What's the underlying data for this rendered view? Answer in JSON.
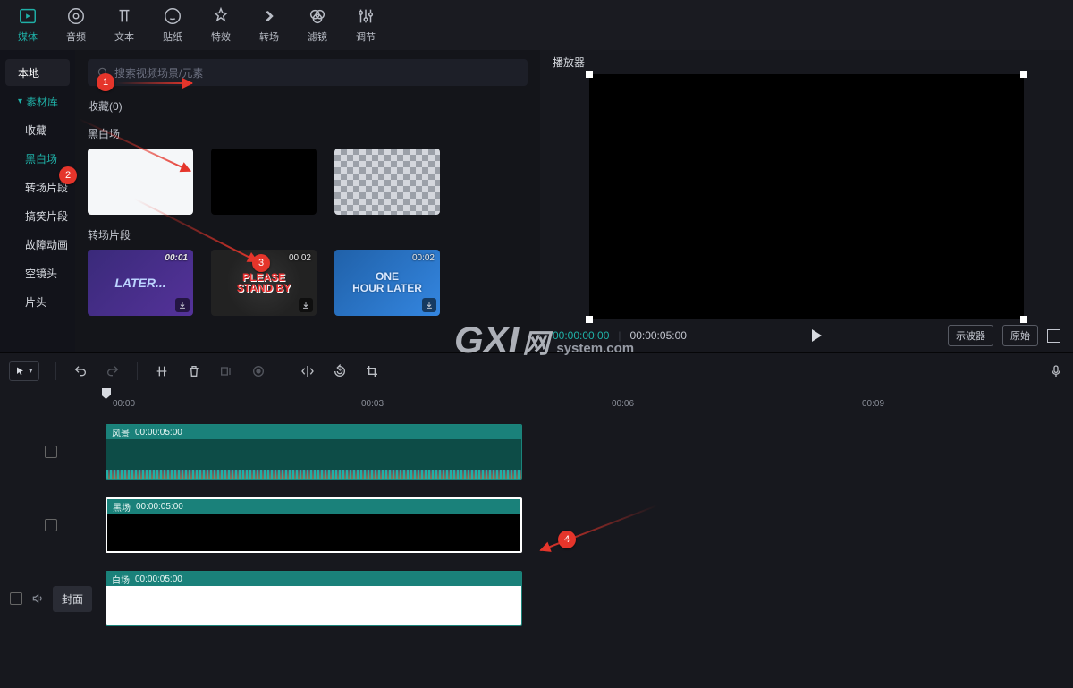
{
  "topTabs": {
    "media": "媒体",
    "audio": "音频",
    "text": "文本",
    "sticker": "贴纸",
    "effect": "特效",
    "transition": "转场",
    "filter": "滤镜",
    "adjust": "调节"
  },
  "side": {
    "local": "本地",
    "library": "素材库",
    "fav": "收藏",
    "bw": "黑白场",
    "trans": "转场片段",
    "funny": "搞笑片段",
    "glitch": "故障动画",
    "empty": "空镜头",
    "opener": "片头"
  },
  "search": {
    "placeholder": "搜索视频场景/元素"
  },
  "sections": {
    "fav": "收藏(0)",
    "bw": "黑白场",
    "trans": "转场片段"
  },
  "thumbDurations": {
    "a": "00:01",
    "b": "00:02",
    "c": "00:02"
  },
  "thumbText": {
    "later": "LATER...",
    "standby": "PLEASE\nSTAND BY",
    "hour": "ONE\nHOUR LATER"
  },
  "player": {
    "title": "播放器",
    "cur": "00:00:00:00",
    "tot": "00:00:05:00",
    "scope": "示波器",
    "orig": "原始"
  },
  "timeline": {
    "ticks": {
      "t0": "00:00",
      "t1": "00:03",
      "t2": "00:06",
      "t3": "00:09"
    },
    "clips": {
      "a": {
        "name": "风景",
        "dur": "00:00:05:00"
      },
      "b": {
        "name": "黑场",
        "dur": "00:00:05:00"
      },
      "c": {
        "name": "白场",
        "dur": "00:00:05:00"
      }
    },
    "cover": "封面"
  },
  "badges": {
    "b1": "1",
    "b2": "2",
    "b3": "3",
    "b4": "4"
  },
  "watermark": {
    "a": "GXI",
    "b": "网",
    "c": "system.com"
  }
}
